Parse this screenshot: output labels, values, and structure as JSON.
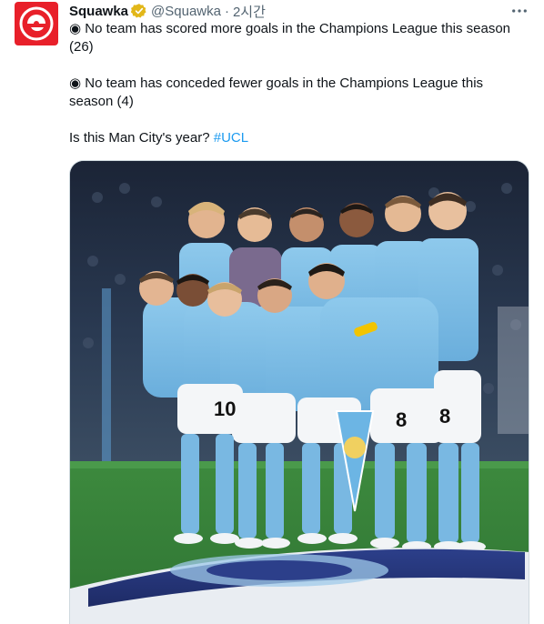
{
  "tweet": {
    "author_name": "Squawka",
    "verified_icon": "verified-badge-gold",
    "handle": "@Squawka",
    "separator": "·",
    "time": "2시간",
    "more_icon": "more-horizontal-icon",
    "lines": [
      "◉ No team has scored more goals in the Champions League this season",
      "(26)",
      "",
      "◉ No team has conceded fewer goals in the Champions League this",
      "season (4)",
      "",
      "Is this Man City's year? "
    ],
    "hashtag": "#UCL"
  },
  "media": {
    "description_icon": "team-photo",
    "shirt_numbers": [
      "10",
      "8",
      "8"
    ]
  },
  "colors": {
    "brand": "#e8202a",
    "link": "#1d9bf0",
    "text": "#0f1419",
    "secondary": "#536471",
    "verified": "#e2b719"
  }
}
